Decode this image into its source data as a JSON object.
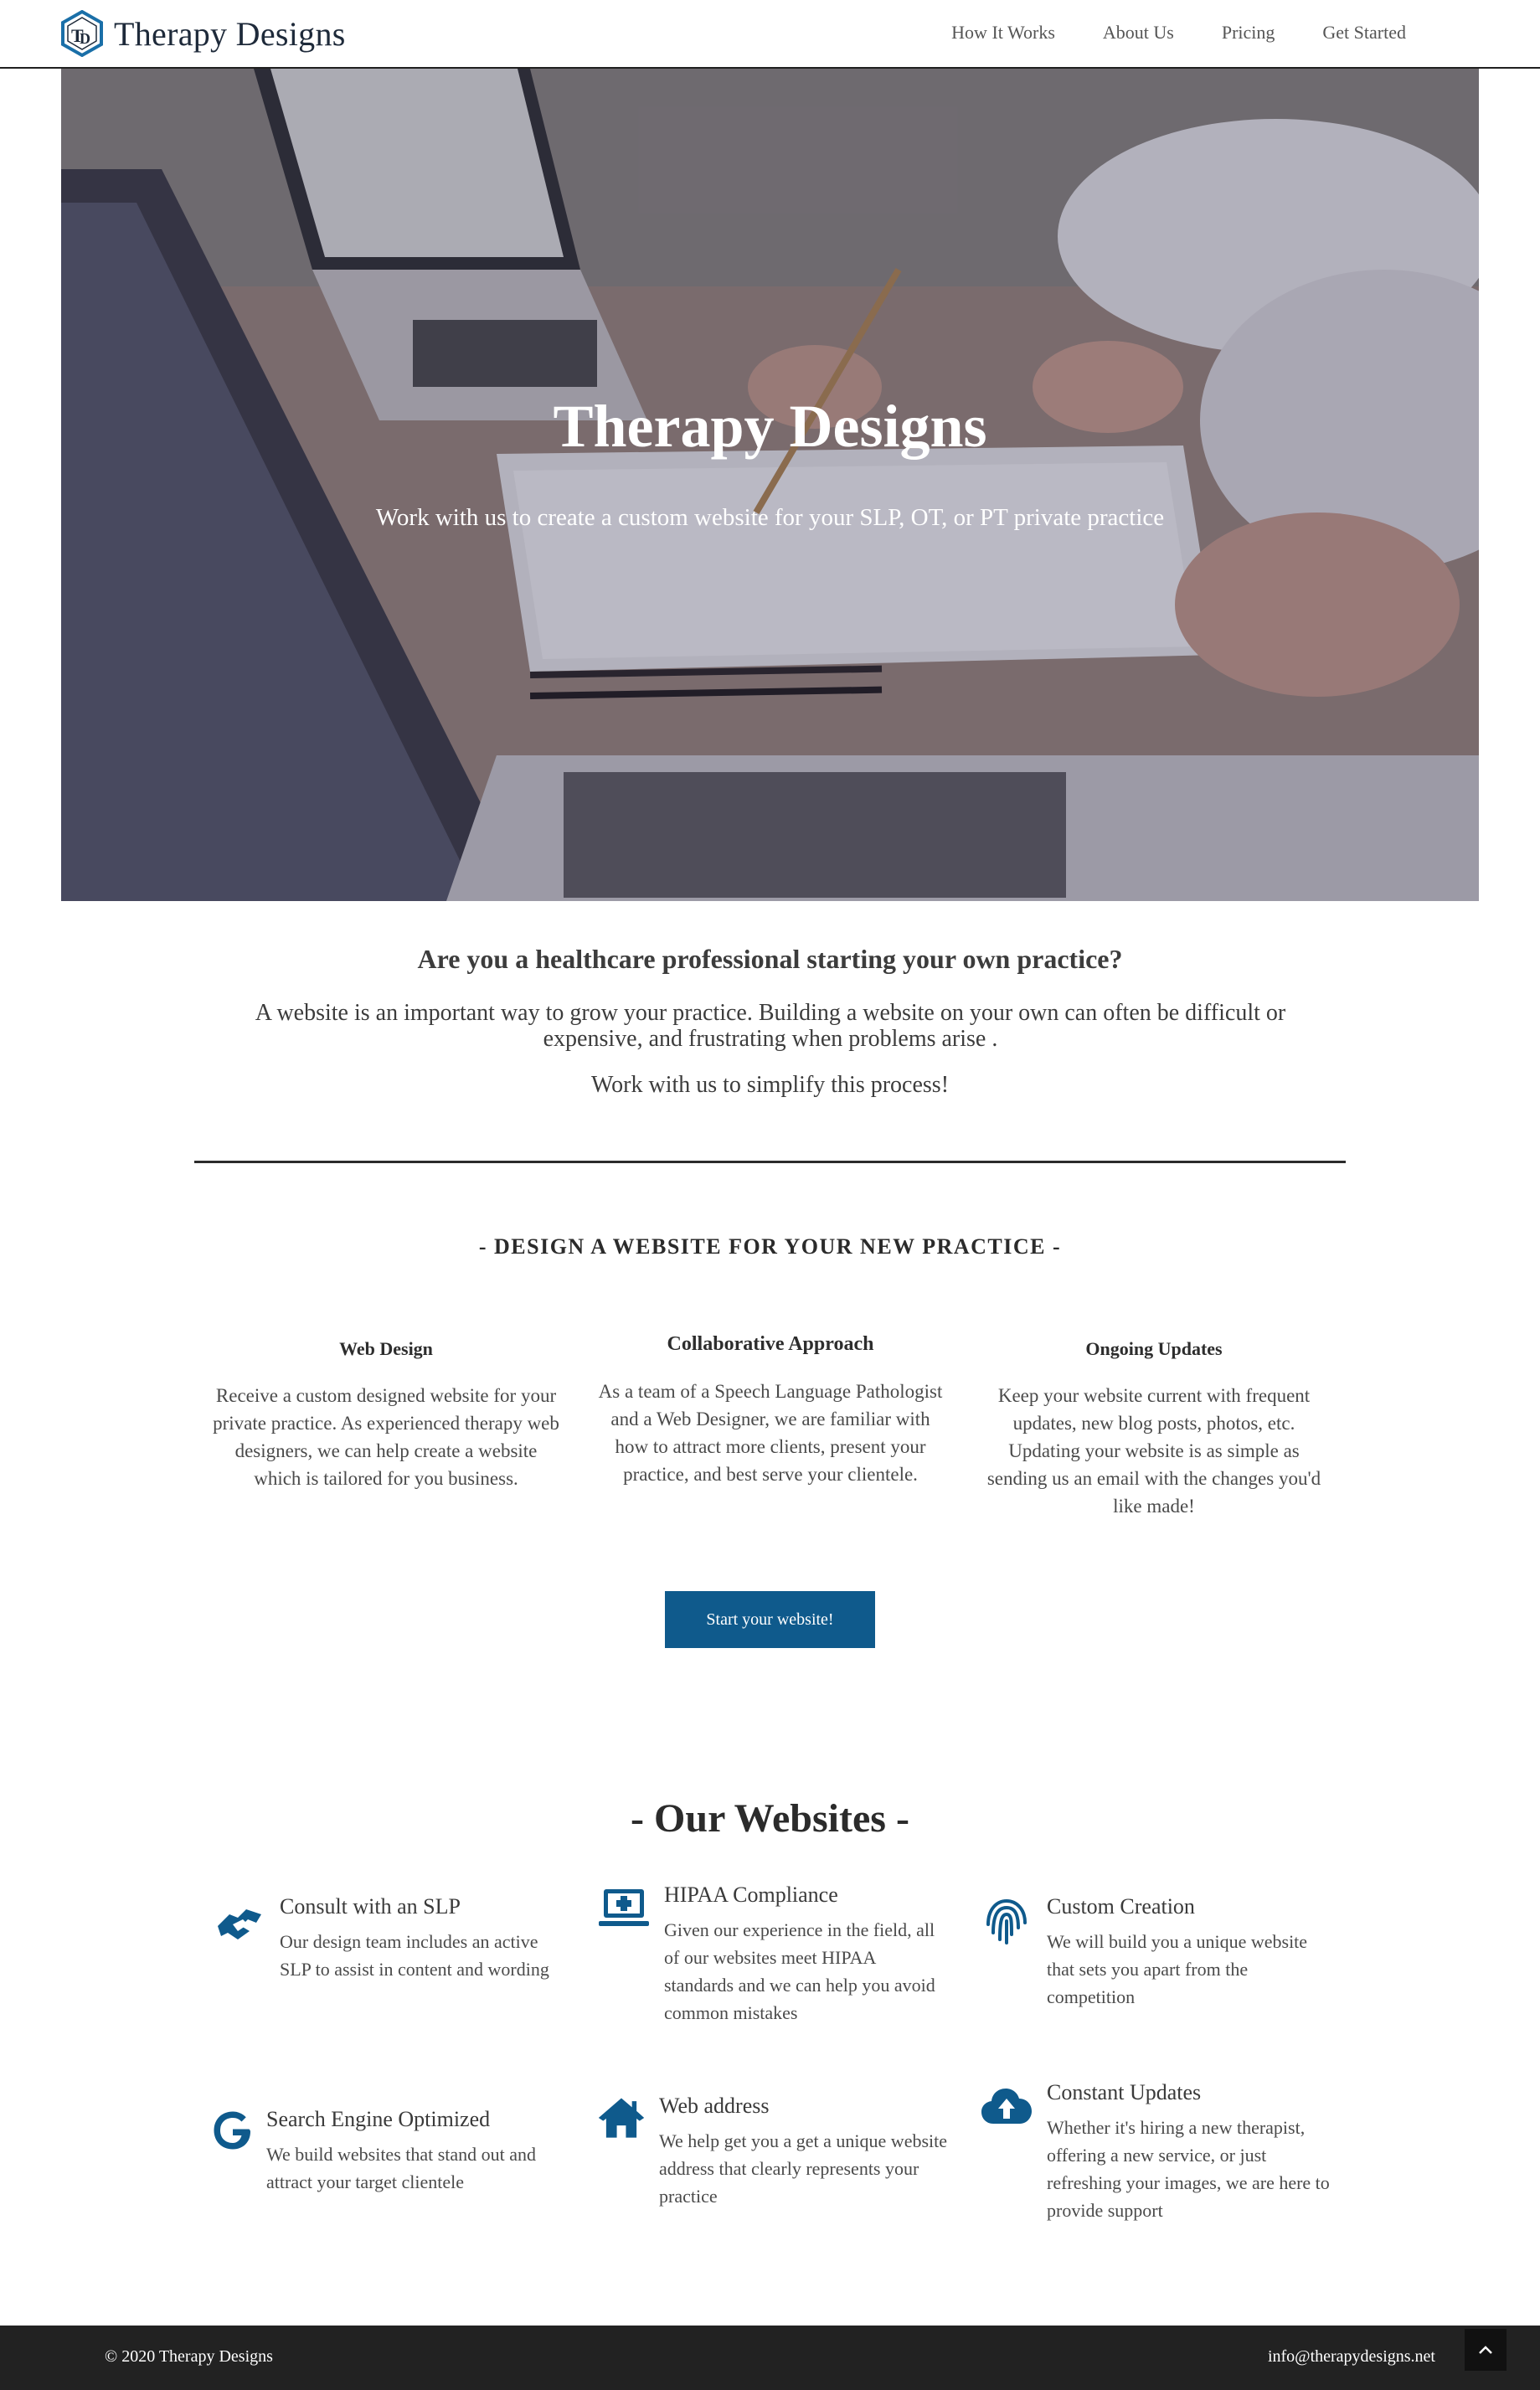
{
  "nav": {
    "brand": "Therapy Designs",
    "links": [
      "How It Works",
      "About Us",
      "Pricing",
      "Get Started"
    ]
  },
  "hero": {
    "title": "Therapy Designs",
    "subtitle": "Work with us to create a custom website for your SLP, OT, or PT private practice"
  },
  "intro": {
    "question": "Are you a healthcare professional starting your own practice?",
    "paragraph": "A website is an important way to grow your practice. Building a website on your own can often be difficult or expensive, and frustrating when problems arise .",
    "cta": "Work with us to simplify this process!"
  },
  "design": {
    "heading": "- DESIGN A WEBSITE FOR YOUR NEW PRACTICE -",
    "features": [
      {
        "title": "Web Design",
        "text": "Receive a custom designed website for your private practice. As experienced therapy web designers, we can help create a website which is tailored for you business."
      },
      {
        "title": "Collaborative Approach",
        "text": "As a team of a Speech Language Pathologist and a Web Designer, we are familiar with how to attract more clients, present your practice, and best serve your clientele."
      },
      {
        "title": "Ongoing Updates",
        "text": "Keep your website current with frequent updates, new blog posts, photos, etc. Updating your website is as simple as sending us an email with the changes you'd like made!"
      }
    ],
    "button": "Start your website!"
  },
  "websites": {
    "heading": "- Our Websites -",
    "services": [
      {
        "icon": "handshake-icon",
        "title": "Consult with an SLP",
        "text": "Our design team includes an active SLP to assist in content and wording"
      },
      {
        "icon": "laptop-medical-icon",
        "title": "HIPAA Compliance",
        "text": "Given our experience in the field, all of our websites meet HIPAA standards and we can help you avoid common mistakes"
      },
      {
        "icon": "fingerprint-icon",
        "title": "Custom Creation",
        "text": "We will build you a unique website that sets you apart from the competition"
      },
      {
        "icon": "google-icon",
        "title": "Search Engine Optimized",
        "text": "We build websites that stand out and attract your target clientele"
      },
      {
        "icon": "home-icon",
        "title": "Web address",
        "text": "We help get you a get a unique website address that clearly represents your practice"
      },
      {
        "icon": "cloud-upload-icon",
        "title": "Constant Updates",
        "text": "Whether it's hiring a new therapist, offering a new service, or just refreshing your images, we are here to provide support"
      }
    ]
  },
  "footer": {
    "copyright": "© 2020 Therapy Designs",
    "email": "info@therapydesigns.net"
  },
  "colors": {
    "accent": "#0f5a8c",
    "footer_bg": "#222222",
    "nav_text": "#555555"
  }
}
